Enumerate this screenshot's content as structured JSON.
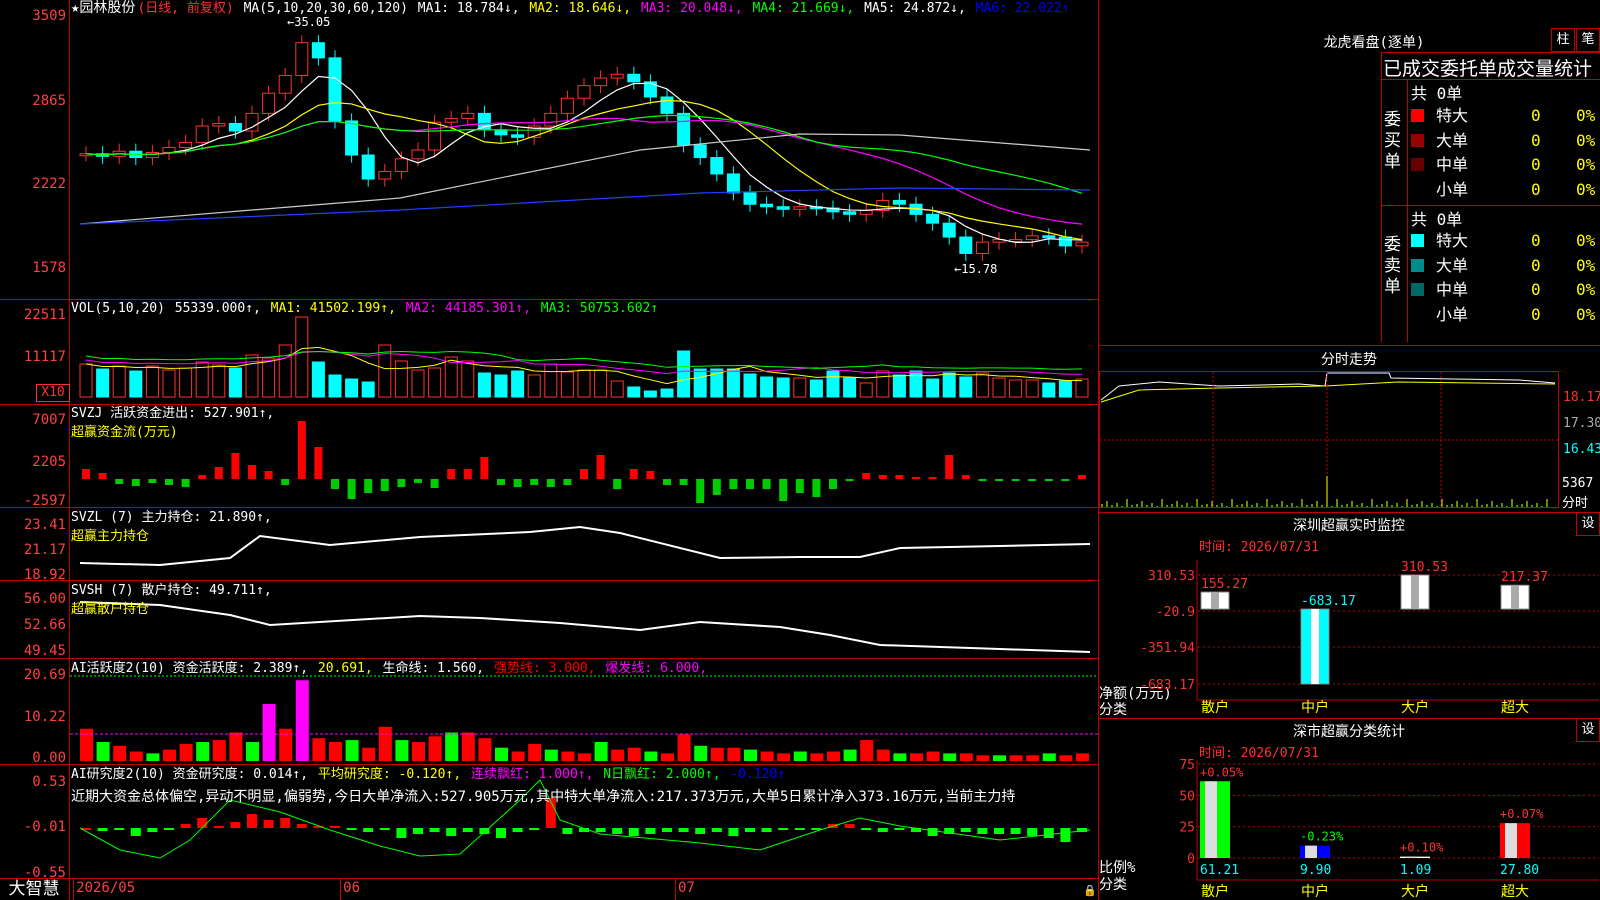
{
  "app": {
    "brand": "大智慧"
  },
  "stock": {
    "title": "★园林股份",
    "mode": "(日线, 前复权)"
  },
  "price": {
    "yaxis": [
      "3509",
      "2865",
      "2222",
      "1578"
    ],
    "ma_label": "MA(5,10,20,30,60,120)",
    "ma": [
      {
        "t": "MA1: 18.784↓,",
        "c": "#ffffff"
      },
      {
        "t": "MA2: 18.646↓,",
        "c": "#ffff00"
      },
      {
        "t": "MA3: 20.048↓,",
        "c": "#ff00ff"
      },
      {
        "t": "MA4: 21.669↓,",
        "c": "#00ff00"
      },
      {
        "t": "MA5: 24.872↓,",
        "c": "#ffffff"
      },
      {
        "t": "MA6: 22.022↑",
        "c": "#0000ff"
      }
    ],
    "high": "←35.05",
    "low": "←15.78"
  },
  "vol": {
    "yaxis": [
      "22511",
      "11117"
    ],
    "unit": "X10",
    "label": "VOL(5,10,20)",
    "value": "55339.000↑,",
    "ma": [
      {
        "t": "MA1: 41502.199↑,",
        "c": "#ffff00"
      },
      {
        "t": "MA2: 44185.301↑,",
        "c": "#ff00ff"
      },
      {
        "t": "MA3: 50753.602↑",
        "c": "#00ff00"
      }
    ]
  },
  "svzj": {
    "yaxis": [
      "7007",
      "2205",
      "-2597"
    ],
    "label": "SVZJ  活跃资金进出: 527.901↑,",
    "sub": "超赢资金流(万元)"
  },
  "svzl": {
    "yaxis": [
      "23.41",
      "21.17",
      "18.92"
    ],
    "label": "SVZL (7) 主力持仓: 21.890↑,",
    "sub": "超赢主力持仓"
  },
  "svsh": {
    "yaxis": [
      "56.00",
      "52.66",
      "49.45"
    ],
    "label": "SVSH (7) 散户持仓: 49.711↑,",
    "sub": "超赢散户持仓"
  },
  "ai1": {
    "yaxis": [
      "20.69",
      "10.22",
      "0.00"
    ],
    "items": [
      {
        "t": "AI活跃度2(10) 资金活跃度: 2.389↑,",
        "c": "#ffffff"
      },
      {
        "t": "20.691,",
        "c": "#ffff00"
      },
      {
        "t": "生命线: 1.560,",
        "c": "#ffffff"
      },
      {
        "t": "强势线: 3.000,",
        "c": "#ff0000"
      },
      {
        "t": "爆发线: 6.000,",
        "c": "#ff00ff"
      }
    ]
  },
  "ai2": {
    "yaxis": [
      "0.53",
      "-0.01",
      "-0.55"
    ],
    "items": [
      {
        "t": "AI研究度2(10) 资金研究度: 0.014↑,",
        "c": "#ffffff"
      },
      {
        "t": "平均研究度: -0.120↑,",
        "c": "#ffff00"
      },
      {
        "t": "连续飘红: 1.000↑,",
        "c": "#ff00ff"
      },
      {
        "t": "N日飘红: 2.000↑,",
        "c": "#00ff00"
      },
      {
        "t": "-0.120↑",
        "c": "#0000ff"
      }
    ],
    "note": "近期大资金总体偏空,异动不明显,偏弱势,今日大单净流入:527.905万元,其中特大单净流入:217.373万元,大单5日累计净入373.16万元,当前主力持"
  },
  "xaxis": [
    {
      "label": "2026/05",
      "pos": 0.005
    },
    {
      "label": "06",
      "pos": 0.265
    },
    {
      "label": "07",
      "pos": 0.591
    }
  ],
  "dragon": {
    "title": "龙虎看盘(逐单)",
    "btn1": "柱",
    "btn2": "笔",
    "tabs": "已成交委托单成交量统计",
    "buy": {
      "label": "委买单",
      "total": "共 0单",
      "rows": [
        {
          "name": "特大",
          "count": "0",
          "pct": "0%",
          "color": "#ff0000"
        },
        {
          "name": "大单",
          "count": "0",
          "pct": "0%",
          "color": "#990000"
        },
        {
          "name": "中单",
          "count": "0",
          "pct": "0%",
          "color": "#660000"
        },
        {
          "name": "小单",
          "count": "0",
          "pct": "0%",
          "color": "#000000"
        }
      ]
    },
    "sell": {
      "label": "委卖单",
      "total": "共 0单",
      "rows": [
        {
          "name": "特大",
          "count": "0",
          "pct": "0%",
          "color": "#00ffff"
        },
        {
          "name": "大单",
          "count": "0",
          "pct": "0%",
          "color": "#008b8b"
        },
        {
          "name": "中单",
          "count": "0",
          "pct": "0%",
          "color": "#006666"
        },
        {
          "name": "小单",
          "count": "0",
          "pct": "0%",
          "color": "#000000"
        }
      ]
    }
  },
  "intraday": {
    "title": "分时走势",
    "yaxis": [
      {
        "t": "18.17",
        "c": "#ff3030"
      },
      {
        "t": "17.30",
        "c": "#aaaaaa"
      },
      {
        "t": "16.43",
        "c": "#00ffff"
      }
    ],
    "vol": "5367",
    "unit": "分时"
  },
  "monitor": {
    "title": "深圳超赢实时监控",
    "btn": "设",
    "time": "时间: 2026/07/31",
    "yaxis": [
      "310.53",
      "-20.9",
      "-351.94",
      "-683.17"
    ],
    "ylabel1": "净额(万元)",
    "ylabel2": "分类",
    "bars": [
      {
        "cat": "散户",
        "v": 155.27,
        "label": "155.27",
        "lc": "#ff3030",
        "color": "#ffffff"
      },
      {
        "cat": "中户",
        "v": -683.17,
        "label": "-683.17",
        "lc": "#00ffff",
        "color": "#00ffff"
      },
      {
        "cat": "大户",
        "v": 310.53,
        "label": "310.53",
        "lc": "#ff3030",
        "color": "#ffffff"
      },
      {
        "cat": "超大",
        "v": 217.37,
        "label": "217.37",
        "lc": "#ff3030",
        "color": "#ffffff"
      }
    ]
  },
  "stats": {
    "title": "深市超赢分类统计",
    "btn": "设",
    "time": "时间: 2026/07/31",
    "yaxis": [
      "75",
      "50",
      "25",
      "0"
    ],
    "ylabel1": "比例%",
    "ylabel2": "分类",
    "bars": [
      {
        "cat": "散户",
        "pct": 61.21,
        "label": "61.21",
        "chg": "+0.05%",
        "color": "#00ff00",
        "cc": "#ff3030"
      },
      {
        "cat": "中户",
        "pct": 9.9,
        "label": "9.90",
        "chg": "-0.23%",
        "color": "#0000ff",
        "cc": "#00ff00"
      },
      {
        "cat": "大户",
        "pct": 1.09,
        "label": "1.09",
        "chg": "+0.10%",
        "color": "#ffffff",
        "cc": "#ff3030"
      },
      {
        "cat": "超大",
        "pct": 27.8,
        "label": "27.80",
        "chg": "+0.07%",
        "color": "#ff0000",
        "cc": "#ff3030"
      }
    ]
  }
}
